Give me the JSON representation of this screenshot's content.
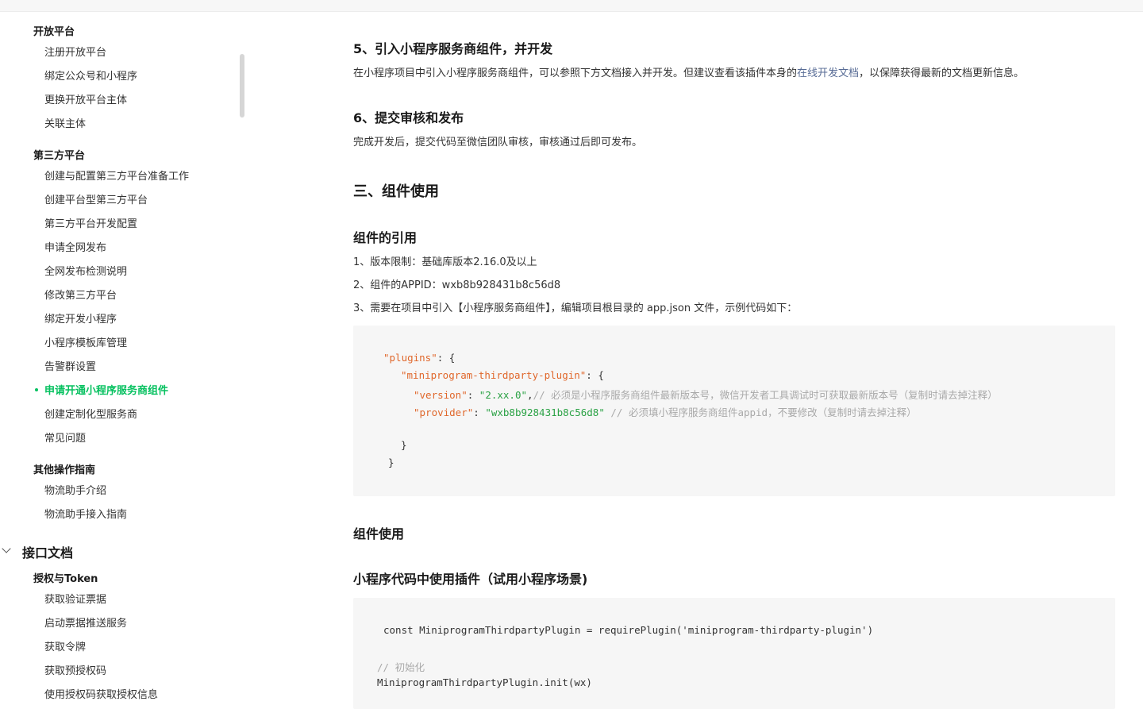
{
  "sidebar": {
    "groups": [
      {
        "title": "开放平台",
        "items": [
          "注册开放平台",
          "绑定公众号和小程序",
          "更换开放平台主体",
          "关联主体"
        ]
      },
      {
        "title": "第三方平台",
        "items": [
          "创建与配置第三方平台准备工作",
          "创建平台型第三方平台",
          "第三方平台开发配置",
          "申请全网发布",
          "全网发布检测说明",
          "修改第三方平台",
          "绑定开发小程序",
          "小程序模板库管理",
          "告警群设置",
          "申请开通小程序服务商组件",
          "创建定制化型服务商",
          "常见问题"
        ]
      },
      {
        "title": "其他操作指南",
        "items": [
          "物流助手介绍",
          "物流助手接入指南"
        ]
      }
    ],
    "section": "接口文档",
    "section_group": {
      "title": "授权与Token",
      "items": [
        "获取验证票据",
        "启动票据推送服务",
        "获取令牌",
        "获取预授权码",
        "使用授权码获取授权信息"
      ]
    },
    "active_item": "申请开通小程序服务商组件",
    "accent_color": "#07c160"
  },
  "content": {
    "h5": "5、引入小程序服务商组件，并开发",
    "p5_before": "在小程序项目中引入小程序服务商组件，可以参照下方文档接入并开发。但建议查看该插件本身的",
    "p5_link": "在线开发文档",
    "p5_after": "，以保障获得最新的文档更新信息。",
    "h6": "6、提交审核和发布",
    "p6": "完成开发后，提交代码至微信团队审核，审核通过后即可发布。",
    "h_section3": "三、组件使用",
    "h_ref": "组件的引用",
    "ref_1": "1、版本限制：基础库版本2.16.0及以上",
    "ref_2": "2、组件的APPID：wxb8b928431b8c56d8",
    "ref_3": "3、需要在项目中引入【小程序服务商组件】，编辑项目根目录的 app.json 文件，示例代码如下：",
    "code1": {
      "l1_key": "\"plugins\"",
      "l1_rest": ": {",
      "l2_key": "\"miniprogram-thirdparty-plugin\"",
      "l2_rest": ": {",
      "l3_key": "\"version\"",
      "l3_colon": ": ",
      "l3_val": "\"2.xx.0\"",
      "l3_comma": ",",
      "l3_comment": "// 必须是小程序服务商组件最新版本号，微信开发者工具调试时可获取最新版本号（复制时请去掉注释）",
      "l4_key": "\"provider\"",
      "l4_colon": ": ",
      "l4_val": "\"wxb8b928431b8c56d8\"",
      "l4_comment": " // 必须填小程序服务商组件appid，不要修改（复制时请去掉注释）",
      "l5": "}",
      "l6": "}"
    },
    "h_use": "组件使用",
    "h_use_code": "小程序代码中使用插件（试用小程序场景)",
    "code2": {
      "l1": "const MiniprogramThirdpartyPlugin = requirePlugin('miniprogram-thirdparty-plugin')",
      "l2_comment": "// 初始化",
      "l3": "MiniprogramThirdpartyPlugin.init(wx)"
    },
    "link_color": "#576b95"
  }
}
